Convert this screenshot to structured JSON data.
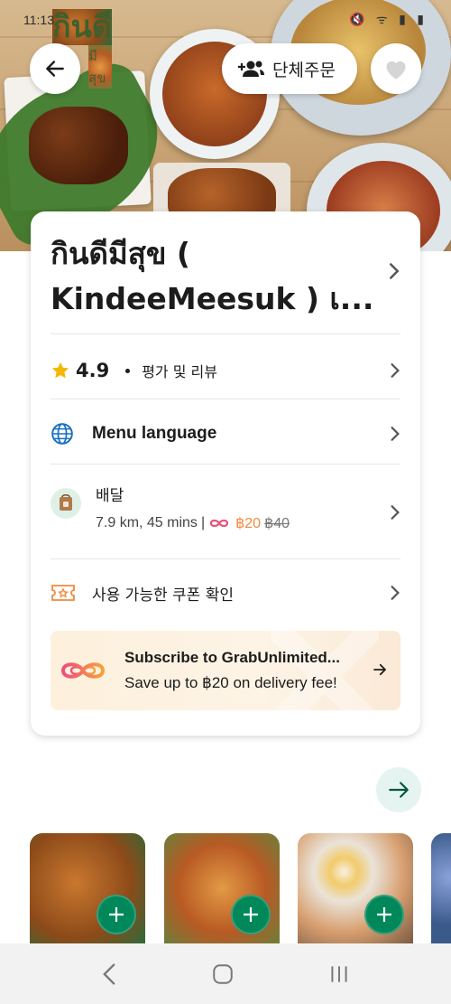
{
  "status_bar": {
    "time": "11:13",
    "icons_text": "🔇 ᯤ ▮ ▮"
  },
  "hero": {
    "logo_text_main": "กินดี",
    "logo_text_sub": "มีสุข",
    "group_order_label": "단체주문"
  },
  "restaurant": {
    "name": "กินดีมีสุข ( KindeeMeesuk ) เ...",
    "rating": "4.9",
    "rating_label": "평가 및 리뷰",
    "menu_language_label": "Menu language",
    "delivery": {
      "title": "배달",
      "distance_time": "7.9 km, 45 mins",
      "separator": "|",
      "fee_discounted": "฿20",
      "fee_original": "฿40"
    },
    "coupon_label": "사용 가능한 쿠폰 확인"
  },
  "promo": {
    "title": "Subscribe to GrabUnlimited...",
    "subtitle": "Save up to ฿20 on delivery fee!"
  },
  "menu_items": [
    {
      "icon": "plus-icon"
    },
    {
      "icon": "plus-icon"
    },
    {
      "icon": "plus-icon"
    }
  ],
  "colors": {
    "brand_green": "#00875a",
    "accent_orange": "#f08a3c",
    "star_yellow": "#f5b800",
    "icon_blue": "#1a6fc4"
  }
}
